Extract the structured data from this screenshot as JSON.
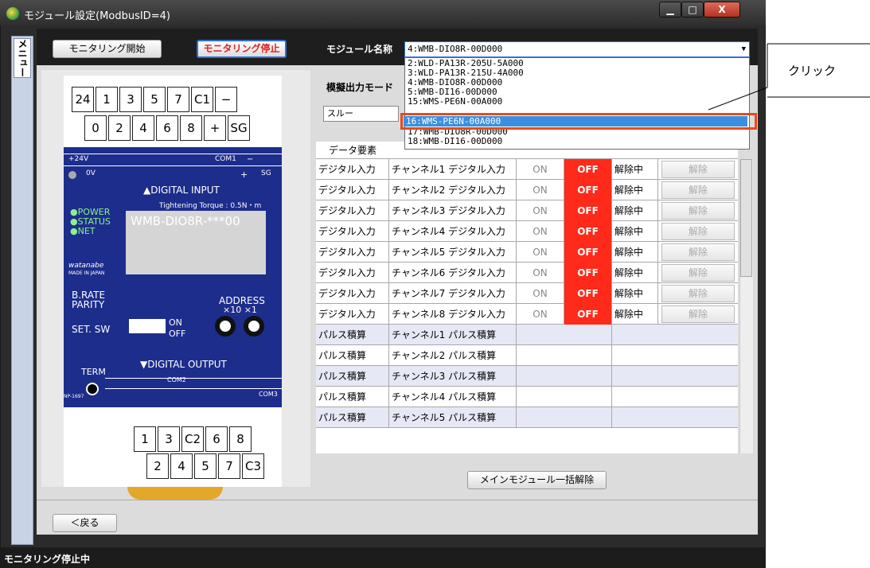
{
  "window": {
    "title": "モジュール設定(ModbusID=4)",
    "minimize": "▁",
    "maximize": "□",
    "close": "X"
  },
  "side_menu": {
    "label": "メニュー"
  },
  "toolbar": {
    "start_label": "モニタリング開始",
    "stop_label": "モニタリング停止",
    "module_label": "モジュール名称",
    "module_value": "4:WMB-DIO8R-00D000"
  },
  "dropdown": {
    "options": [
      "2:WLD-PA13R-205U-5A000",
      "3:WLD-PA13R-215U-4A000",
      "4:WMB-DIO8R-00D000",
      "5:WMB-DI16-00D000",
      "15:WMS-PE6N-00A000",
      "16:WMS-PE6N-00A000",
      "17:WMB-DIO8R-00D000",
      "18:WMB-DI16-00D000"
    ],
    "selected": "16:WMS-PE6N-00A000"
  },
  "callout": {
    "text": "クリック"
  },
  "simulation": {
    "label": "模擬出力モード",
    "mode": "スルー"
  },
  "device": {
    "top_row1": [
      "24",
      "1",
      "3",
      "5",
      "7",
      "C1",
      "−"
    ],
    "top_row2": [
      "0",
      "2",
      "4",
      "6",
      "8",
      "+",
      "SG"
    ],
    "bot_row1": [
      "1",
      "3",
      "C2",
      "6",
      "8"
    ],
    "bot_row2": [
      "2",
      "4",
      "5",
      "7",
      "C3"
    ],
    "digital_input": "▲DIGITAL INPUT",
    "torque": "Tightening Torque : 0.5N・m",
    "model": "WMB-DIO8R-***00",
    "leds": [
      "●POWER",
      "●STATUS",
      "●NET"
    ],
    "brand": "watanabe",
    "made_in": "MADE IN JAPAN",
    "rate_label": "B.RATE",
    "parity_label": "PARITY",
    "address_label": "ADDRESS",
    "address_mult": "×10  ×1",
    "set_sw": "SET. SW",
    "on": "ON",
    "off": "OFF",
    "digital_output": "▼DIGITAL OUTPUT",
    "term": "TERM",
    "part_no": "NP-1697",
    "plus24": "+24V",
    "ov": "0V",
    "com1": "COM1",
    "com2": "COM2",
    "com3": "COM3",
    "sg": "SG",
    "plus": "+",
    "minus": "−"
  },
  "table": {
    "header": {
      "element": "データ要素"
    },
    "digital_rows": [
      {
        "type": "デジタル入力",
        "name": "チャンネル1 デジタル入力",
        "on": "ON",
        "off": "OFF",
        "state": "解除中",
        "release": "解除"
      },
      {
        "type": "デジタル入力",
        "name": "チャンネル2 デジタル入力",
        "on": "ON",
        "off": "OFF",
        "state": "解除中",
        "release": "解除"
      },
      {
        "type": "デジタル入力",
        "name": "チャンネル3 デジタル入力",
        "on": "ON",
        "off": "OFF",
        "state": "解除中",
        "release": "解除"
      },
      {
        "type": "デジタル入力",
        "name": "チャンネル4 デジタル入力",
        "on": "ON",
        "off": "OFF",
        "state": "解除中",
        "release": "解除"
      },
      {
        "type": "デジタル入力",
        "name": "チャンネル5 デジタル入力",
        "on": "ON",
        "off": "OFF",
        "state": "解除中",
        "release": "解除"
      },
      {
        "type": "デジタル入力",
        "name": "チャンネル6 デジタル入力",
        "on": "ON",
        "off": "OFF",
        "state": "解除中",
        "release": "解除"
      },
      {
        "type": "デジタル入力",
        "name": "チャンネル7 デジタル入力",
        "on": "ON",
        "off": "OFF",
        "state": "解除中",
        "release": "解除"
      },
      {
        "type": "デジタル入力",
        "name": "チャンネル8 デジタル入力",
        "on": "ON",
        "off": "OFF",
        "state": "解除中",
        "release": "解除"
      }
    ],
    "pulse_rows": [
      {
        "type": "パルス積算",
        "name": "チャンネル1 パルス積算"
      },
      {
        "type": "パルス積算",
        "name": "チャンネル2 パルス積算"
      },
      {
        "type": "パルス積算",
        "name": "チャンネル3 パルス積算"
      },
      {
        "type": "パルス積算",
        "name": "チャンネル4 パルス積算"
      },
      {
        "type": "パルス積算",
        "name": "チャンネル5 パルス積算"
      }
    ]
  },
  "bottom": {
    "reset_all": "メインモジュール一括解除"
  },
  "footer": {
    "back": "＜戻る"
  },
  "status": {
    "text": "モニタリング停止中"
  },
  "colors": {
    "accent": "#2f6fd8",
    "off_red": "#ff2a1a",
    "highlight": "#e84a1a",
    "device_blue": "#1d2d8c"
  }
}
